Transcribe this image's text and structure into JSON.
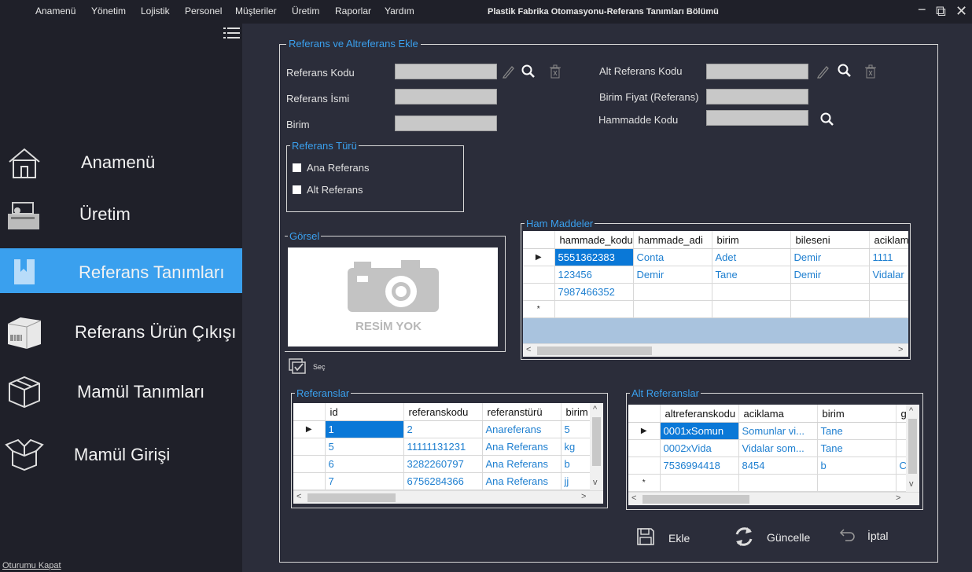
{
  "menu": [
    "Anamenü",
    "Yönetim",
    "Lojistik",
    "Personel",
    "Müşteriler",
    "Üretim",
    "Raporlar",
    "Yardım"
  ],
  "window_title": "Plastik Fabrika Otomasyonu-Referans Tanımları Bölümü",
  "window_controls": {
    "minimize": "−",
    "restore": "⧉",
    "close": "✕"
  },
  "sidebar": {
    "items": [
      {
        "label": "Anamenü",
        "icon": "home-icon"
      },
      {
        "label": "Üretim",
        "icon": "machine-icon"
      },
      {
        "label": "Referans Tanımları",
        "icon": "bookmark-icon"
      },
      {
        "label": "Referans Ürün Çıkışı",
        "icon": "box-barcode-icon"
      },
      {
        "label": "Mamül Tanımları",
        "icon": "package-icon"
      },
      {
        "label": "Mamül Girişi",
        "icon": "open-box-icon"
      }
    ],
    "logout": "Oturumu Kapat"
  },
  "form": {
    "group_title": "Referans ve Altreferans Ekle",
    "referans_kodu_label": "Referans Kodu",
    "referans_ismi_label": "Referans İsmi",
    "birim_label": "Birim",
    "alt_referans_kodu_label": "Alt Referans Kodu",
    "birim_fiyat_label": "Birim Fiyat (Referans)",
    "hammadde_kodu_label": "Hammadde Kodu",
    "referans_turu": {
      "title": "Referans Türü",
      "options": [
        "Ana Referans",
        "Alt Referans"
      ]
    },
    "gorsel": {
      "title": "Görsel",
      "placeholder": "RESİM YOK",
      "select_label": "Seç"
    }
  },
  "ham_maddeler": {
    "title": "Ham Maddeler",
    "columns": [
      "hammade_kodu",
      "hammade_adi",
      "birim",
      "bileseni",
      "aciklama"
    ],
    "rows": [
      [
        "5551362383",
        "Conta",
        "Adet",
        "Demir",
        "1111"
      ],
      [
        "123456",
        "Demir",
        "Tane",
        "Demir",
        "Vidalar"
      ],
      [
        "7987466352",
        "",
        "",
        "",
        ""
      ]
    ]
  },
  "referanslar": {
    "title": "Referanslar",
    "columns": [
      "id",
      "referanskodu",
      "referanstürü",
      "birim"
    ],
    "rows": [
      [
        "1",
        "2",
        "Anareferans",
        "5"
      ],
      [
        "5",
        "11111131231",
        "Ana Referans",
        "kg"
      ],
      [
        "6",
        "3282260797",
        "Ana Referans",
        "b"
      ],
      [
        "7",
        "6756284366",
        "Ana Referans",
        "jj"
      ]
    ]
  },
  "alt_referanslar": {
    "title": "Alt Referanslar",
    "columns": [
      "altreferanskodu",
      "aciklama",
      "birim",
      "g"
    ],
    "rows": [
      [
        "0001xSomun",
        "Somunlar vi...",
        "Tane",
        ""
      ],
      [
        "0002xVida",
        "Vidalar som...",
        "Tane",
        ""
      ],
      [
        "7536994418",
        "8454",
        "b",
        "C"
      ]
    ]
  },
  "buttons": {
    "ekle": "Ekle",
    "guncelle": "Güncelle",
    "iptal": "İptal"
  },
  "colors": {
    "accent": "#3aa0ee",
    "sidebar": "#1f2029",
    "background": "#2b2d3a",
    "selection": "#0a78d7"
  }
}
